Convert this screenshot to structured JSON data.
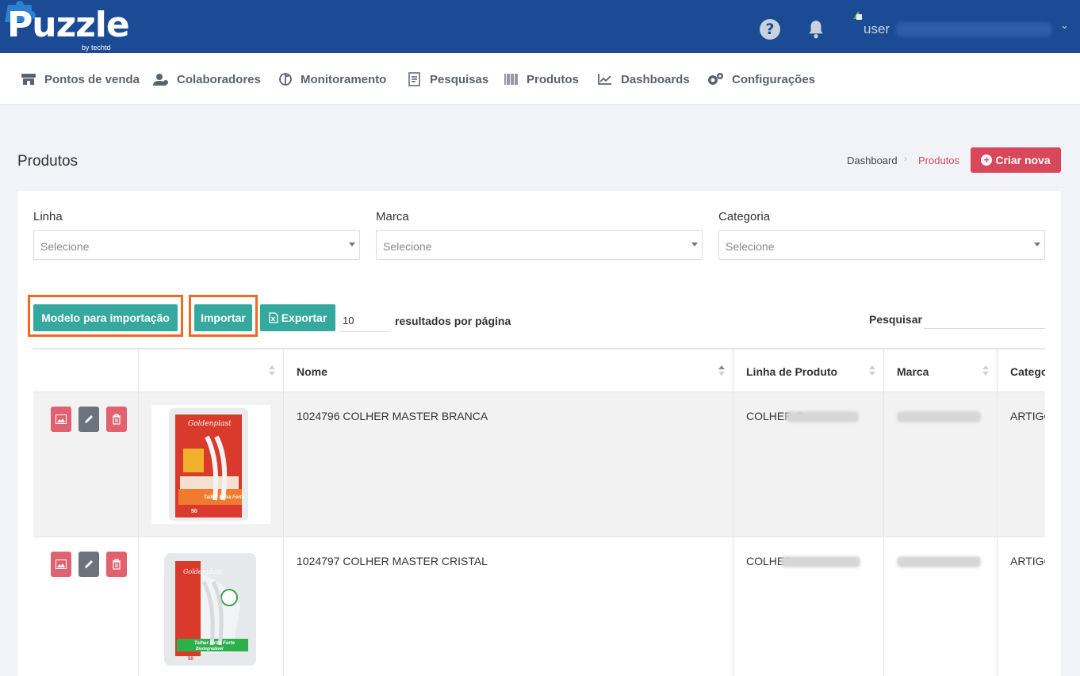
{
  "app": {
    "logo_text": "Puzzle",
    "logo_sub": "by techtd",
    "user_label": "user"
  },
  "nav": [
    {
      "label": "Pontos de venda",
      "icon": "store-icon"
    },
    {
      "label": "Colaboradores",
      "icon": "users-icon"
    },
    {
      "label": "Monitoramento",
      "icon": "monitor-icon"
    },
    {
      "label": "Pesquisas",
      "icon": "survey-icon"
    },
    {
      "label": "Produtos",
      "icon": "barcode-icon"
    },
    {
      "label": "Dashboards",
      "icon": "chart-icon"
    },
    {
      "label": "Configurações",
      "icon": "gears-icon"
    }
  ],
  "page": {
    "title": "Produtos",
    "breadcrumb": {
      "home": "Dashboard",
      "current": "Produtos"
    },
    "create_label": "Criar nova"
  },
  "filters": [
    {
      "label": "Linha",
      "placeholder": "Selecione"
    },
    {
      "label": "Marca",
      "placeholder": "Selecione"
    },
    {
      "label": "Categoria",
      "placeholder": "Selecione"
    }
  ],
  "toolbar": {
    "template_label": "Modelo para importação",
    "import_label": "Importar",
    "export_label": "Exportar",
    "per_page_value": "10",
    "per_page_label": "resultados por página",
    "search_label": "Pesquisar"
  },
  "table": {
    "columns": [
      "",
      "",
      "Nome",
      "Linha de Produto",
      "Marca",
      "Catego"
    ],
    "rows": [
      {
        "nome": "1024796 COLHER MASTER BRANCA",
        "linha": "COLHER C",
        "marca": "",
        "categoria": "ARTIGO"
      },
      {
        "nome": "1024797 COLHER MASTER CRISTAL",
        "linha": "COLHER",
        "marca": "",
        "categoria": "ARTIGO"
      }
    ]
  },
  "product_images": [
    {
      "brand": "Goldenplast",
      "caption": "Talher Extra Forte",
      "count": "50"
    },
    {
      "brand": "Goldenplast",
      "caption": "Talher Extra Forte",
      "caption2": "Biodegradável",
      "count": "50"
    }
  ],
  "colors": {
    "topbar": "#1a4b94",
    "accent_teal": "#36a99f",
    "accent_red": "#d9475a",
    "highlight_orange": "#f26722"
  }
}
